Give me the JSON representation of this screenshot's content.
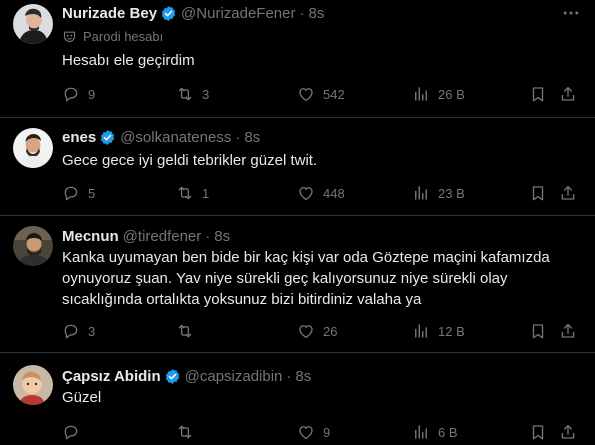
{
  "tweets": [
    {
      "name": "Nurizade Bey",
      "handle": "@NurizadeFener",
      "time": "8s",
      "verified": true,
      "parody_label": "Parodi hesabı",
      "text": "Hesabı ele geçirdim",
      "replies": "9",
      "retweets": "3",
      "likes": "542",
      "views": "26 B"
    },
    {
      "name": "enes",
      "handle": "@solkanateness",
      "time": "8s",
      "verified": true,
      "text": "Gece gece iyi geldi tebrikler güzel twit.",
      "replies": "5",
      "retweets": "1",
      "likes": "448",
      "views": "23 B"
    },
    {
      "name": "Mecnun",
      "handle": "@tiredfener",
      "time": "8s",
      "verified": false,
      "text": "Kanka uyumayan ben bide bir kaç kişi var oda Göztepe maçini kafamızda oynuyoruz şuan. Yav niye sürekli geç kalıyorsunuz niye sürekli olay sıcaklığında ortalıkta yoksunuz bizi bitirdiniz valaha ya",
      "replies": "3",
      "retweets": "",
      "likes": "26",
      "views": "12 B"
    },
    {
      "name": "Çapsız Abidin",
      "handle": "@capsizadibin",
      "time": "8s",
      "verified": true,
      "text": "Güzel",
      "replies": "",
      "retweets": "",
      "likes": "9",
      "views": "6 B"
    }
  ],
  "separator": "·",
  "icons": [
    "reply-icon",
    "retweet-icon",
    "like-icon",
    "views-icon",
    "bookmark-icon",
    "share-icon",
    "more-icon",
    "verified-icon",
    "parody-mask-icon"
  ],
  "colors": {
    "background": "#000000",
    "text": "#e7e9ea",
    "muted": "#71767b",
    "verified": "#1d9bf0",
    "divider": "#2f3336"
  }
}
